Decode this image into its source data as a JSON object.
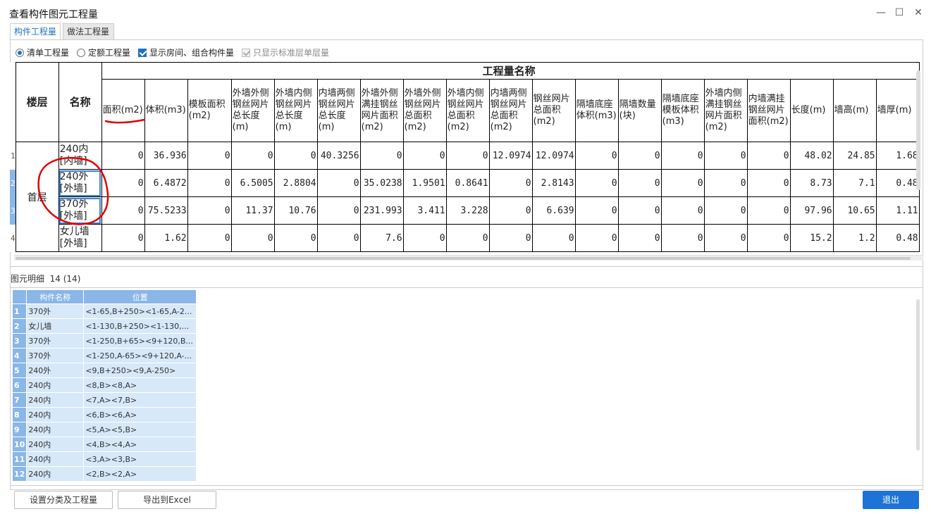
{
  "window": {
    "title": "查看构件图元工程量",
    "minimize": "—",
    "maximize": "☐",
    "close": "✕"
  },
  "tabs": [
    {
      "label": "构件工程量",
      "active": true
    },
    {
      "label": "做法工程量",
      "active": false
    }
  ],
  "options": {
    "radio_qingdan": "清单工程量",
    "radio_dinge": "定额工程量",
    "check_show_room": "显示房间、组合构件量",
    "check_only_std": "只显示标准层单层量"
  },
  "quantity_table": {
    "col_floor": "楼层",
    "col_name": "名称",
    "group_header": "工程量名称",
    "columns": [
      "面积(m2)",
      "体积(m3)",
      "模板面积(m2)",
      "外墙外侧钢丝网片总长度(m)",
      "外墙内侧钢丝网片总长度(m)",
      "内墙两侧钢丝网片总长度(m)",
      "外墙外侧满挂钢丝网片面积(m2)",
      "外墙外侧钢丝网片总面积(m2)",
      "外墙内侧钢丝网片总面积(m2)",
      "内墙两侧钢丝网片总面积(m2)",
      "钢丝网片总面积(m2)",
      "隔墙底座体积(m3)",
      "隔墙数量(块)",
      "隔墙底座模板体积(m3)",
      "外墙内侧满挂钢丝网片面积(m2)",
      "内墙满挂钢丝网片面积(m2)",
      "长度(m)",
      "墙高(m)",
      "墙厚(m)"
    ],
    "floor": "首层",
    "rows": [
      {
        "n": "1",
        "name": "240内 [内墙]",
        "values": [
          "0",
          "36.936",
          "0",
          "0",
          "0",
          "40.3256",
          "0",
          "0",
          "0",
          "12.0974",
          "12.0974",
          "0",
          "0",
          "0",
          "0",
          "0",
          "48.02",
          "24.85",
          "1.68"
        ]
      },
      {
        "n": "2",
        "name": "240外 [外墙]",
        "values": [
          "0",
          "6.4872",
          "0",
          "6.5005",
          "2.8804",
          "0",
          "35.0238",
          "1.9501",
          "0.8641",
          "0",
          "2.8143",
          "0",
          "0",
          "0",
          "0",
          "0",
          "8.73",
          "7.1",
          "0.48"
        ]
      },
      {
        "n": "3",
        "name": "370外 [外墙]",
        "values": [
          "0",
          "75.5233",
          "0",
          "11.37",
          "10.76",
          "0",
          "231.993",
          "3.411",
          "3.228",
          "0",
          "6.639",
          "0",
          "0",
          "0",
          "0",
          "0",
          "97.96",
          "10.65",
          "1.11"
        ]
      },
      {
        "n": "4",
        "name": "女儿墙 [外墙]",
        "values": [
          "0",
          "1.62",
          "0",
          "0",
          "0",
          "0",
          "7.6",
          "0",
          "0",
          "0",
          "0",
          "0",
          "0",
          "0",
          "0",
          "0",
          "15.2",
          "1.2",
          "0.48"
        ]
      }
    ]
  },
  "detail": {
    "label": "图元明细",
    "count": "14 (14)",
    "headers": [
      "构件名称",
      "位置"
    ],
    "rows": [
      {
        "n": "1",
        "name": "370外",
        "pos": "<1-65,B+250><1-65,A-2..."
      },
      {
        "n": "2",
        "name": "女儿墙",
        "pos": "<1-130,B+250><1-130,..."
      },
      {
        "n": "3",
        "name": "370外",
        "pos": "<1-250,B+65><9+120,B..."
      },
      {
        "n": "4",
        "name": "370外",
        "pos": "<1-250,A-65><9+120,A-..."
      },
      {
        "n": "5",
        "name": "240外",
        "pos": "<9,B+250><9,A-250>"
      },
      {
        "n": "6",
        "name": "240内",
        "pos": "<8,B><8,A>"
      },
      {
        "n": "7",
        "name": "240内",
        "pos": "<7,A><7,B>"
      },
      {
        "n": "8",
        "name": "240内",
        "pos": "<6,B><6,A>"
      },
      {
        "n": "9",
        "name": "240内",
        "pos": "<5,A><5,B>"
      },
      {
        "n": "10",
        "name": "240内",
        "pos": "<4,B><4,A>"
      },
      {
        "n": "11",
        "name": "240内",
        "pos": "<3,A><3,B>"
      },
      {
        "n": "12",
        "name": "240内",
        "pos": "<2,B><2,A>"
      }
    ]
  },
  "buttons": {
    "settings": "设置分类及工程量",
    "export": "导出到Excel",
    "exit": "退出"
  },
  "colors": {
    "accent": "#1e73d6",
    "selection": "#8ab6e8",
    "row_fill": "#d7e8f9",
    "annotation": "#e00000"
  }
}
